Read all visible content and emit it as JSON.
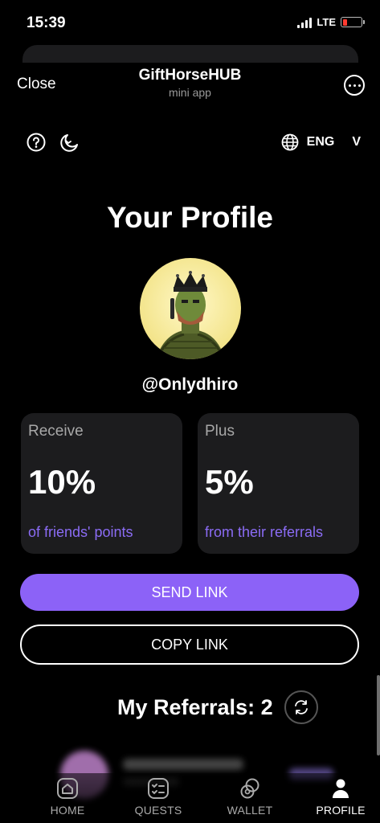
{
  "status_bar": {
    "time": "15:39",
    "network": "LTE",
    "battery_color": "#ff3b30"
  },
  "topbar": {
    "close_label": "Close",
    "app_title": "GiftHorseHUB",
    "app_subtitle": "mini app",
    "more_icon": "more-horizontal-icon"
  },
  "toolbar": {
    "help_icon": "question-circle-icon",
    "theme_icon": "moon-icon",
    "language_icon": "globe-icon",
    "language_code": "ENG",
    "language_dropdown": "V"
  },
  "profile": {
    "title": "Your Profile",
    "username": "@Onlydhiro"
  },
  "cards": [
    {
      "label": "Receive",
      "value": "10%",
      "note": "of friends' points"
    },
    {
      "label": "Plus",
      "value": "5%",
      "note": "from their referrals"
    }
  ],
  "actions": {
    "send_label": "SEND LINK",
    "copy_label": "COPY LINK"
  },
  "referrals": {
    "title": "My Referrals: 2"
  },
  "tabs": [
    {
      "label": "HOME",
      "icon": "home-icon",
      "active": false
    },
    {
      "label": "QUESTS",
      "icon": "checklist-icon",
      "active": false
    },
    {
      "label": "WALLET",
      "icon": "coins-icon",
      "active": false
    },
    {
      "label": "PROFILE",
      "icon": "person-icon",
      "active": true
    }
  ],
  "colors": {
    "accent": "#8c62f7",
    "card_bg": "#1c1c1e",
    "accent_text": "#8b6cf5"
  }
}
